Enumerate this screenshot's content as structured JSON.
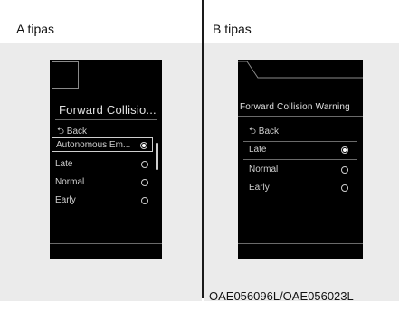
{
  "panel_a": {
    "heading": "A tipas",
    "screen": {
      "title": "Forward Collisio...",
      "back_label": "Back",
      "items": [
        {
          "label": "Autonomous Em...",
          "selected": true
        },
        {
          "label": "Late",
          "selected": false
        },
        {
          "label": "Normal",
          "selected": false
        },
        {
          "label": "Early",
          "selected": false
        }
      ]
    }
  },
  "panel_b": {
    "heading": "B tipas",
    "screen": {
      "title": "Forward Collision Warning",
      "back_label": "Back",
      "items": [
        {
          "label": "Late",
          "selected": true
        },
        {
          "label": "Normal",
          "selected": false
        },
        {
          "label": "Early",
          "selected": false
        }
      ]
    }
  },
  "footer": {
    "code": "OAE056096L/OAE056023L"
  },
  "icons": {
    "back": "back-arrow-icon",
    "radio": "radio-icon"
  }
}
